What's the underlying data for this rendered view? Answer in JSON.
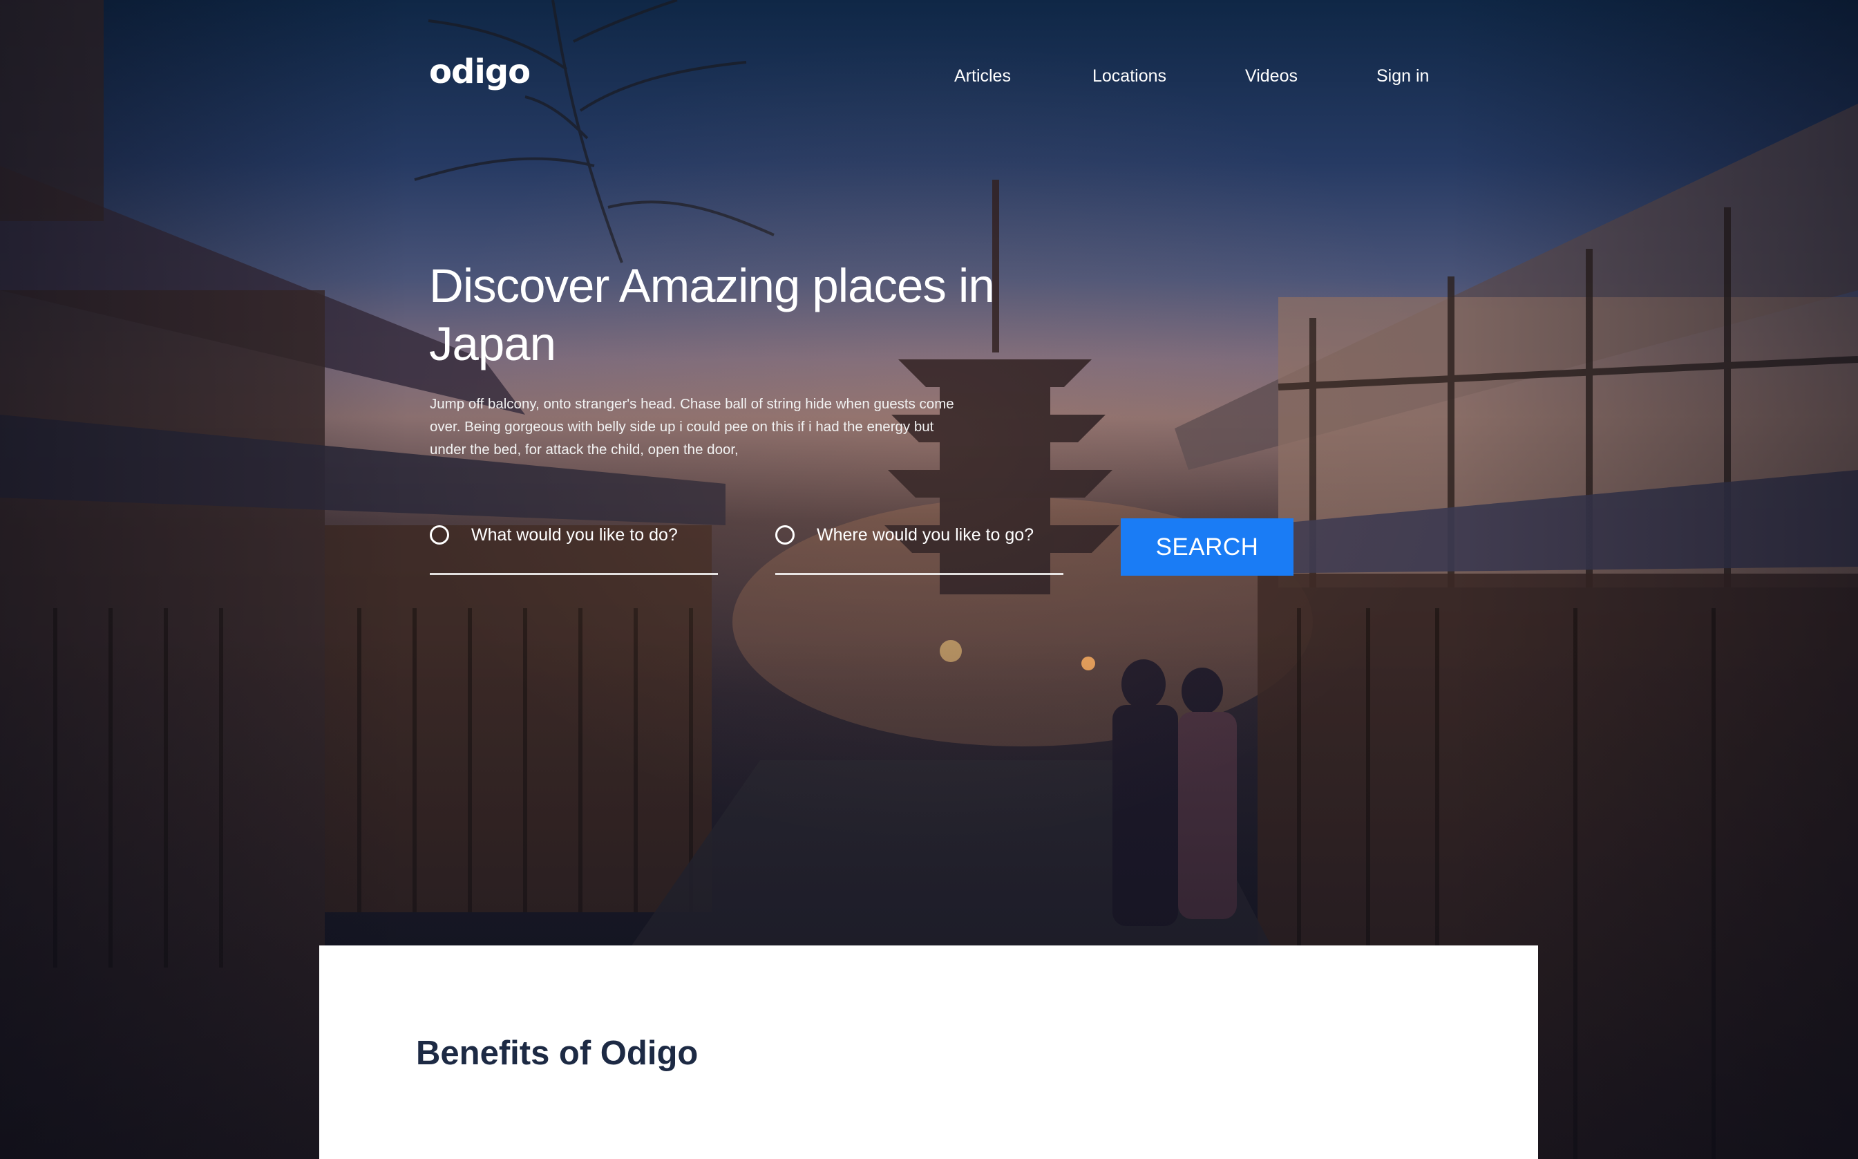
{
  "brand": {
    "logo_text": "odigo"
  },
  "nav": {
    "items": [
      {
        "label": "Articles"
      },
      {
        "label": "Locations"
      },
      {
        "label": "Videos"
      },
      {
        "label": "Sign in"
      }
    ]
  },
  "hero": {
    "title": "Discover Amazing places in Japan",
    "description": "Jump off balcony, onto stranger's head. Chase ball of string hide when guests come over. Being gorgeous with belly side up i could pee on this if i had the energy but under the bed, for attack the child, open the door,",
    "background_icon": "kyoto-street-pagoda-photo"
  },
  "search": {
    "activity_placeholder": "What would you like to do?",
    "location_placeholder": "Where would you like to go?",
    "button_label": "SEARCH",
    "button_color": "#1a7cf5"
  },
  "benefits": {
    "title": "Benefits of Odigo"
  },
  "colors": {
    "title_dark": "#1d2a44",
    "panel_bg": "#ffffff",
    "text_light": "#ffffff"
  }
}
